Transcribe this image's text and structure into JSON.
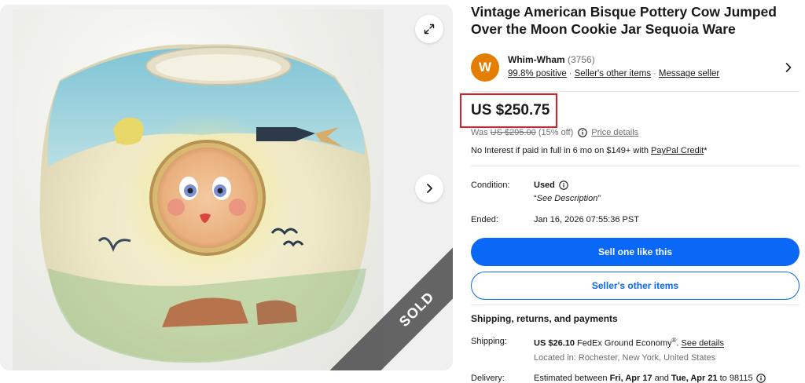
{
  "listing": {
    "title": "Vintage American Bisque Pottery Cow Jumped Over the Moon Cookie Jar Sequoia Ware",
    "sold_badge": "SOLD"
  },
  "seller": {
    "avatar_letter": "W",
    "name": "Whim-Wham",
    "feedback_count": "(3756)",
    "positive": "99.8% positive",
    "other_items": "Seller's other items",
    "message": "Message seller"
  },
  "price": {
    "current": "US $250.75",
    "was_prefix": "Was",
    "was_value": "US $295.00",
    "discount": "(15% off)",
    "details_link": "Price details",
    "paypal_text": "No Interest if paid in full in 6 mo on $149+ with",
    "paypal_link": "PayPal Credit",
    "paypal_suffix": "*"
  },
  "details": {
    "condition_label": "Condition:",
    "condition_value": "Used",
    "condition_desc_open": "“",
    "condition_desc": "See Description",
    "condition_desc_close": "”",
    "ended_label": "Ended:",
    "ended_value": "Jan 16, 2026 07:55:36 PST"
  },
  "buttons": {
    "sell_like": "Sell one like this",
    "seller_items": "Seller's other items"
  },
  "shipping": {
    "heading": "Shipping, returns, and payments",
    "shipping_label": "Shipping:",
    "shipping_cost": "US $26.10",
    "shipping_method": "FedEx Ground Economy",
    "shipping_reg": "®",
    "see_details": "See details",
    "location": "Located in: Rochester, New York, United States",
    "delivery_label": "Delivery:",
    "delivery_prefix": "Estimated between",
    "delivery_start": "Fri, Apr 17",
    "delivery_and": "and",
    "delivery_end": "Tue, Apr 21",
    "delivery_to": "to 98115"
  },
  "colors": {
    "primary_blue": "#0968f6",
    "highlight_red": "#e31b23",
    "avatar_orange": "#e57e00"
  },
  "icons": [
    "expand-icon",
    "chevron-right-icon",
    "info-icon"
  ]
}
